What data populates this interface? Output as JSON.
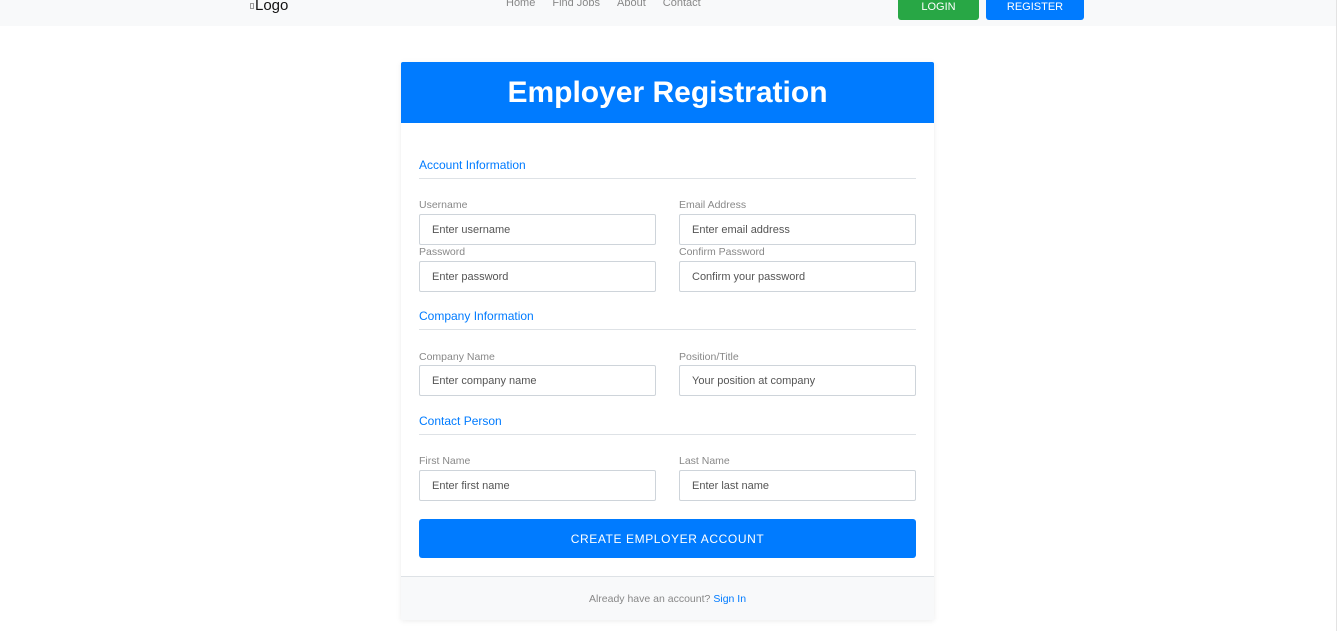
{
  "nav": {
    "logo_alt": "Logo",
    "links": [
      "Home",
      "Find Jobs",
      "About",
      "Contact"
    ],
    "login": "LOGIN",
    "register": "REGISTER"
  },
  "form": {
    "title": "Employer Registration",
    "sections": {
      "account": "Account Information",
      "company": "Company Information",
      "contact": "Contact Person"
    },
    "fields": {
      "username": {
        "label": "Username",
        "placeholder": "Enter username"
      },
      "email": {
        "label": "Email Address",
        "placeholder": "Enter email address"
      },
      "password": {
        "label": "Password",
        "placeholder": "Enter password"
      },
      "confirm_password": {
        "label": "Confirm Password",
        "placeholder": "Confirm your password"
      },
      "company_name": {
        "label": "Company Name",
        "placeholder": "Enter company name"
      },
      "position": {
        "label": "Position/Title",
        "placeholder": "Your position at company"
      },
      "first_name": {
        "label": "First Name",
        "placeholder": "Enter first name"
      },
      "last_name": {
        "label": "Last Name",
        "placeholder": "Enter last name"
      }
    },
    "submit": "CREATE EMPLOYER ACCOUNT",
    "footer_text": "Already have an account?",
    "footer_link": "Sign In"
  },
  "colors": {
    "primary": "#007bff",
    "success": "#28a745"
  }
}
